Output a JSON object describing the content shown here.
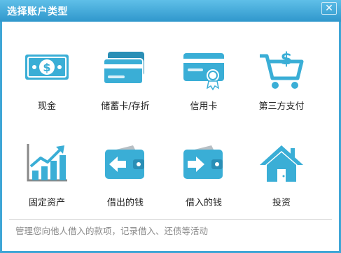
{
  "window": {
    "title": "选择账户类型",
    "close_glyph": "✕"
  },
  "tiles": [
    {
      "label": "现金",
      "icon": "cash-banknote-icon"
    },
    {
      "label": "储蓄卡/存折",
      "icon": "savings-cards-icon"
    },
    {
      "label": "信用卡",
      "icon": "credit-card-icon"
    },
    {
      "label": "第三方支付",
      "icon": "shopping-cart-dollar-icon"
    },
    {
      "label": "固定资产",
      "icon": "growth-chart-icon"
    },
    {
      "label": "借出的钱",
      "icon": "wallet-arrow-out-icon"
    },
    {
      "label": "借入的钱",
      "icon": "wallet-arrow-in-icon"
    },
    {
      "label": "投资",
      "icon": "house-icon"
    }
  ],
  "hint": "管理您向他人借入的款项，记录借入、还债等活动",
  "colors": {
    "accent": "#3aaed6",
    "accent_dark": "#2a8fb6",
    "title_bar": "#3fa6d6"
  }
}
